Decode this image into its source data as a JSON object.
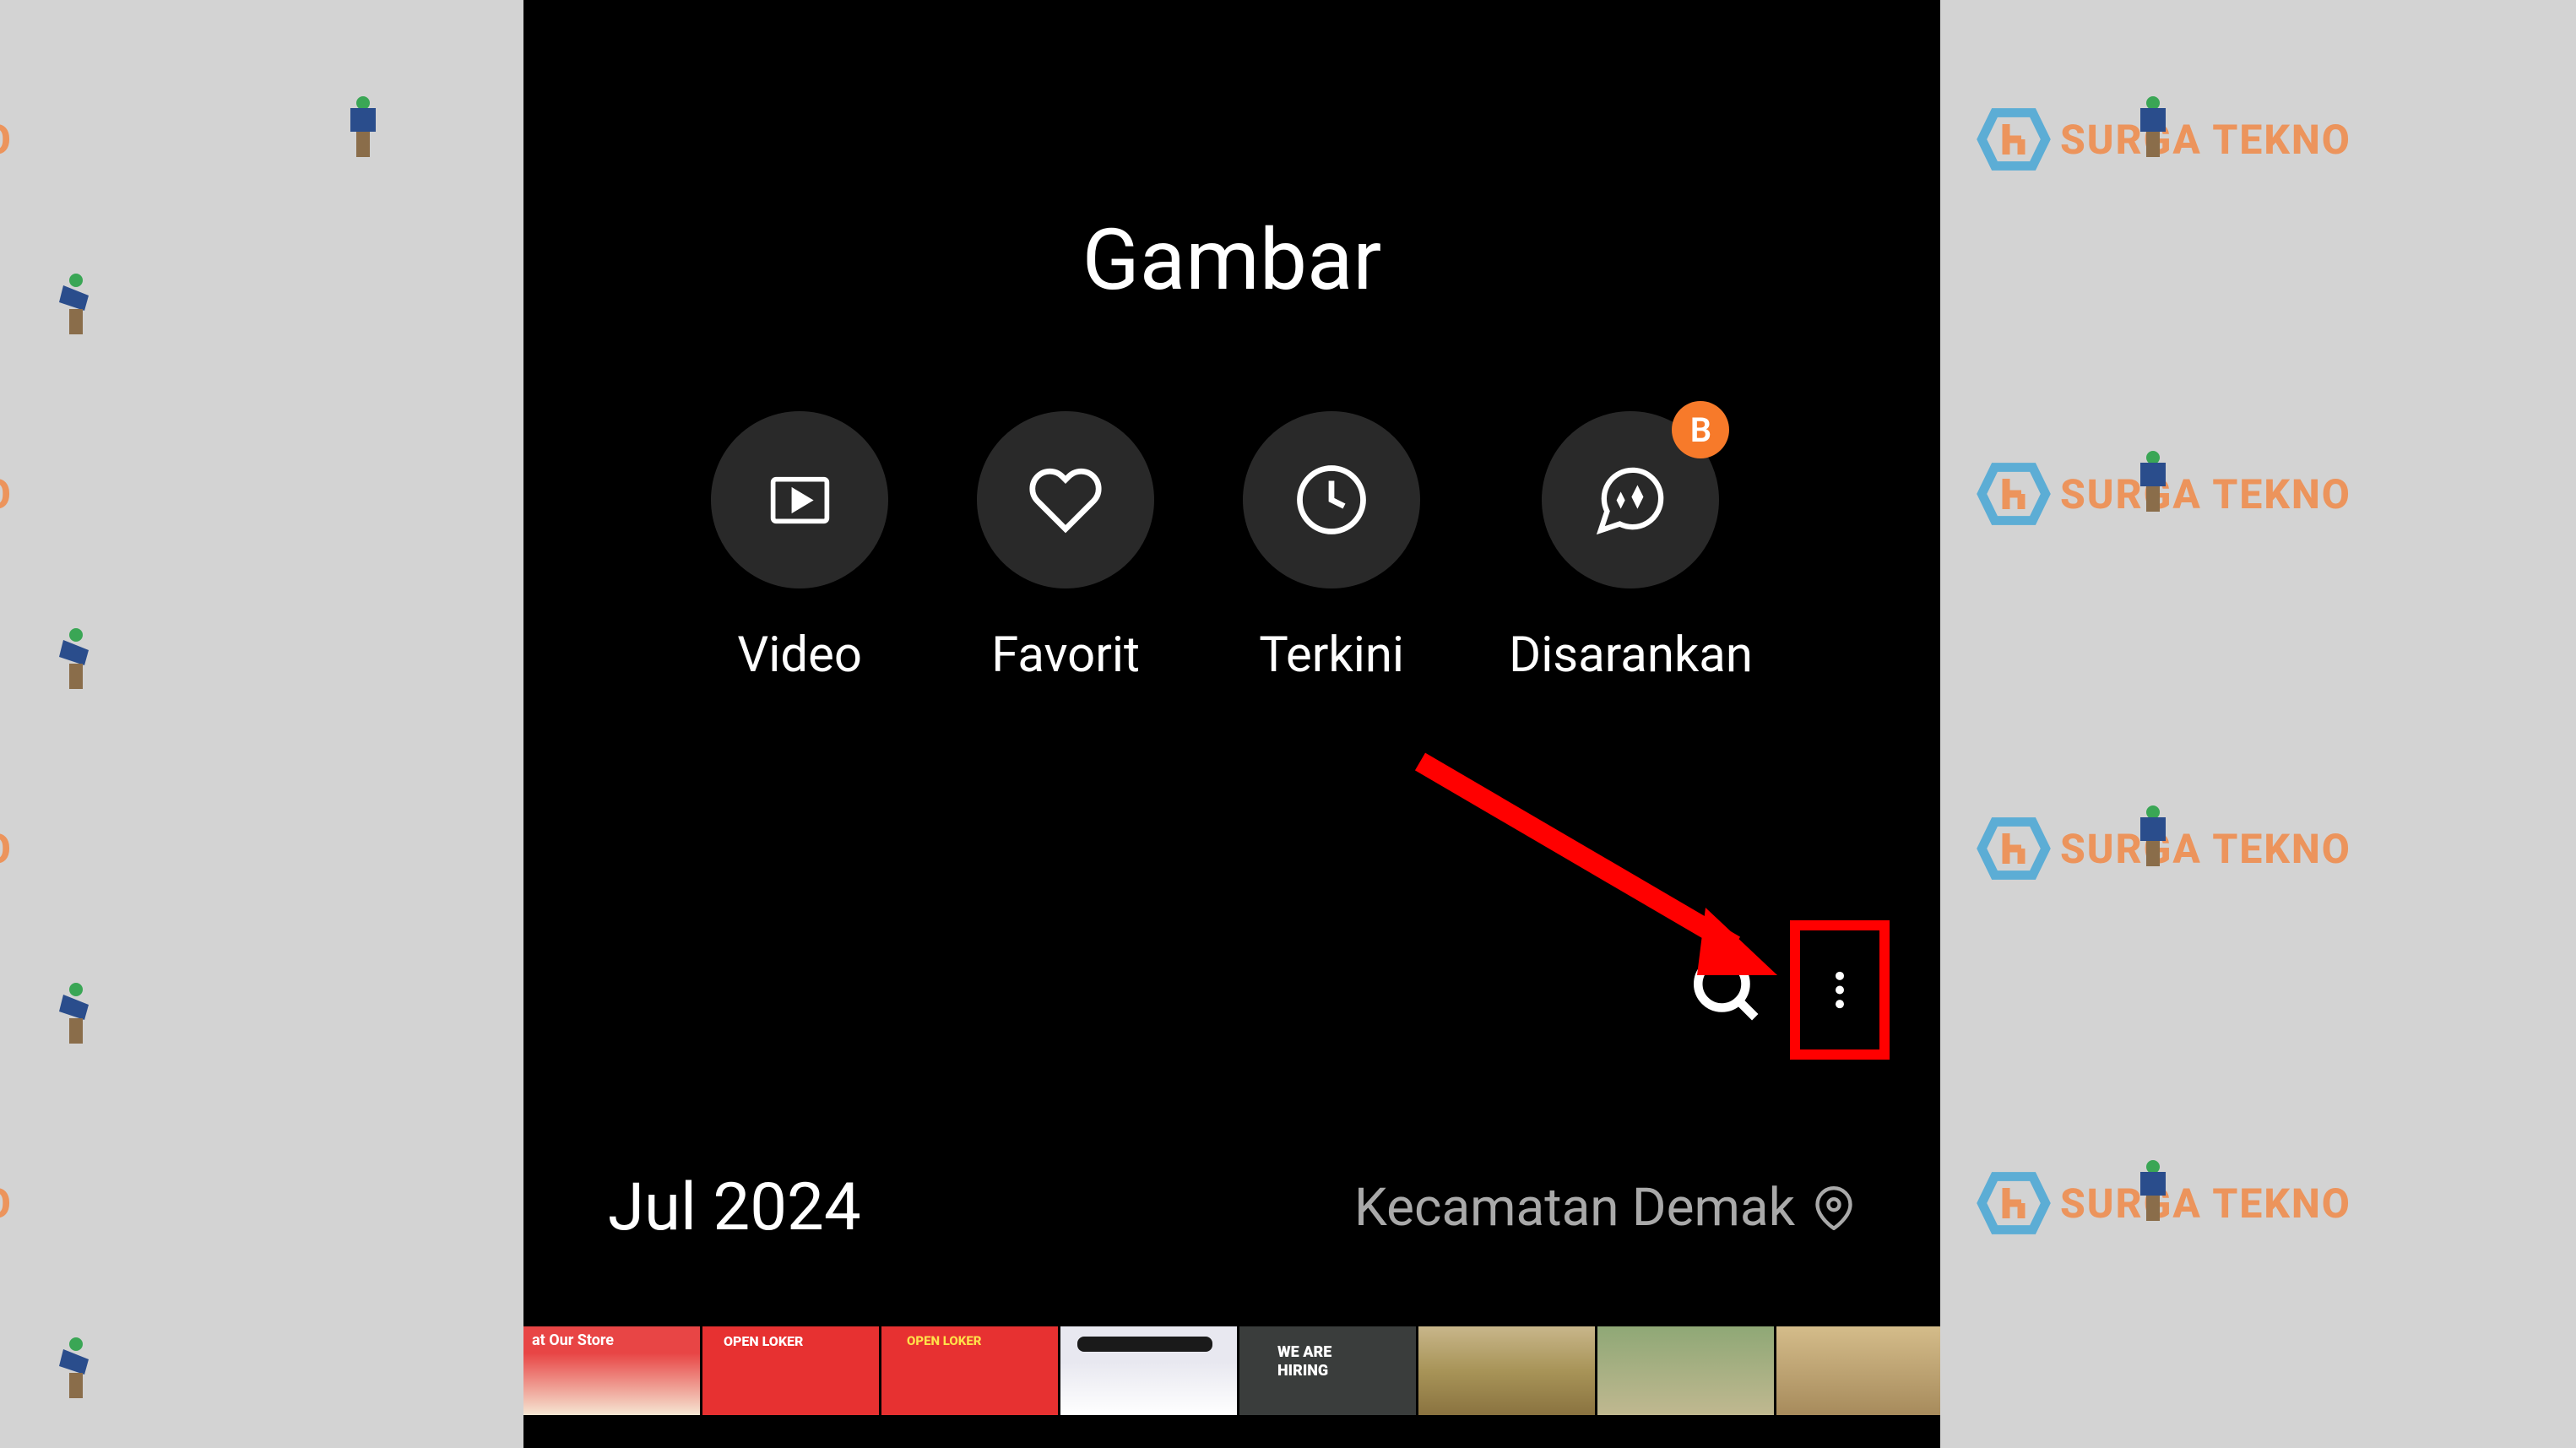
{
  "header": {
    "title": "Gambar"
  },
  "categories": {
    "video": {
      "label": "Video"
    },
    "favorite": {
      "label": "Favorit"
    },
    "recent": {
      "label": "Terkini"
    },
    "suggested": {
      "label": "Disarankan",
      "badge": "B"
    }
  },
  "gallery": {
    "date": "Jul 2024",
    "location": "Kecamatan Demak"
  },
  "watermark": {
    "text": "SURGA TEKNO"
  }
}
